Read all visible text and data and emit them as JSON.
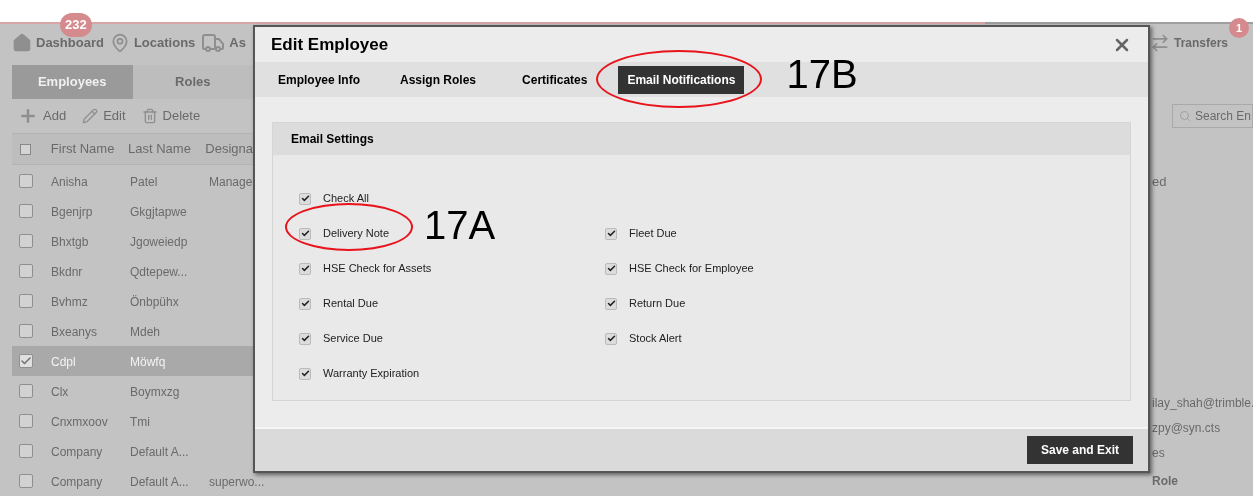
{
  "nav": {
    "items": [
      {
        "kind": "home",
        "label": "Dashboard",
        "badge": "232"
      },
      {
        "kind": "pin",
        "label": "Locations"
      },
      {
        "kind": "truck",
        "label": "As"
      }
    ],
    "right_item": {
      "label": "Transfers",
      "badge": "1"
    }
  },
  "tabs": [
    {
      "label": "Employees",
      "selected": true
    },
    {
      "label": "Roles",
      "selected": false
    }
  ],
  "toolbar": [
    {
      "kind": "add",
      "label": "Add"
    },
    {
      "kind": "edit",
      "label": "Edit"
    },
    {
      "kind": "delete",
      "label": "Delete"
    }
  ],
  "search": {
    "placeholder": "Search En"
  },
  "table": {
    "header_checked": false,
    "columns": [
      "First Name",
      "Last Name",
      "Designa"
    ],
    "rows": [
      {
        "cells": [
          "Anisha",
          "Patel",
          "Manage"
        ],
        "selected": false
      },
      {
        "cells": [
          "Bgenjrp",
          "Gkgjtapwe",
          ""
        ],
        "selected": false
      },
      {
        "cells": [
          "Bhxtgb",
          "Jgoweiedp",
          ""
        ],
        "selected": false
      },
      {
        "cells": [
          "Bkdnr",
          "Qdtepew...",
          ""
        ],
        "selected": false
      },
      {
        "cells": [
          "Bvhmz",
          "Önbpühx",
          ""
        ],
        "selected": false
      },
      {
        "cells": [
          "Bxeanys",
          "Mdeh",
          ""
        ],
        "selected": false
      },
      {
        "cells": [
          "Cdpl",
          "Möwfq",
          ""
        ],
        "selected": true
      },
      {
        "cells": [
          "Clx",
          "Boymxzg",
          ""
        ],
        "selected": false
      },
      {
        "cells": [
          "Cnxmxoov",
          "Tmi",
          ""
        ],
        "selected": false
      },
      {
        "cells": [
          "Company",
          "Default A...",
          ""
        ],
        "selected": false
      },
      {
        "cells": [
          "Company",
          "Default A...",
          "superwo..."
        ],
        "selected": false
      }
    ]
  },
  "right_column": {
    "header": "ed",
    "emails": [
      "ilay_shah@trimble.",
      "zpy@syn.cts"
    ],
    "column_3": "es",
    "column_4": "Role"
  },
  "dialog": {
    "title": "Edit Employee",
    "tabs": [
      {
        "label": "Employee Info",
        "selected": false
      },
      {
        "label": "Assign Roles",
        "selected": false
      },
      {
        "label": "Certificates",
        "selected": false
      },
      {
        "label": "Email Notifications",
        "selected": true,
        "annotation": "17B"
      }
    ],
    "panel_title": "Email Settings",
    "options": [
      {
        "label": "Check All",
        "checked": true
      },
      {
        "label": "Delivery Note",
        "checked": true,
        "annotation": "17A"
      },
      {
        "label": "Fleet Due",
        "checked": true
      },
      {
        "label": "HSE Check for Assets",
        "checked": true
      },
      {
        "label": "HSE Check for Employee",
        "checked": true
      },
      {
        "label": "Rental Due",
        "checked": true
      },
      {
        "label": "Return Due",
        "checked": true
      },
      {
        "label": "Service Due",
        "checked": true
      },
      {
        "label": "Stock Alert",
        "checked": true
      },
      {
        "label": "Warranty Expiration",
        "checked": true
      }
    ],
    "save_button": "Save and Exit"
  }
}
